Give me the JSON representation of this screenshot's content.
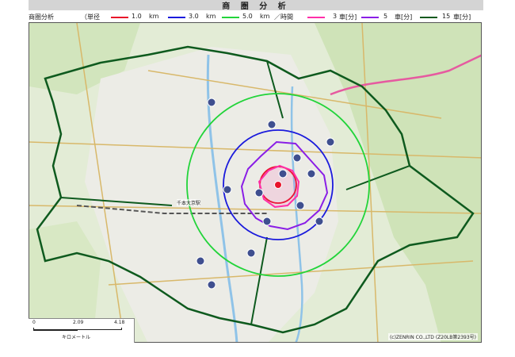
{
  "header": {
    "title": "商 圏 分 析"
  },
  "legend": {
    "label": "商圏分析",
    "radius_label": "（単径",
    "time_label": "／時間",
    "radius_items": [
      {
        "value": "1.0",
        "unit": "km",
        "color": "#e8142a"
      },
      {
        "value": "3.0",
        "unit": "km",
        "color": "#1a1adc"
      },
      {
        "value": "5.0",
        "unit": "km",
        "color": "#22d43a"
      }
    ],
    "time_items": [
      {
        "value": "3",
        "unit": "車[分]",
        "color": "#ff2fa8"
      },
      {
        "value": "5",
        "unit": "車[分]",
        "color": "#8a1ee6"
      },
      {
        "value": "15",
        "unit": "車[分]",
        "color": "#0e5a1e"
      }
    ]
  },
  "map": {
    "station_label": "千本大京駅",
    "scale": {
      "ticks": [
        "0",
        "2.09",
        "4.18"
      ],
      "unit": "キロメートル"
    },
    "copyright": "(c)ZENRIN CO.,LTD (Z20LB第2393号)"
  }
}
